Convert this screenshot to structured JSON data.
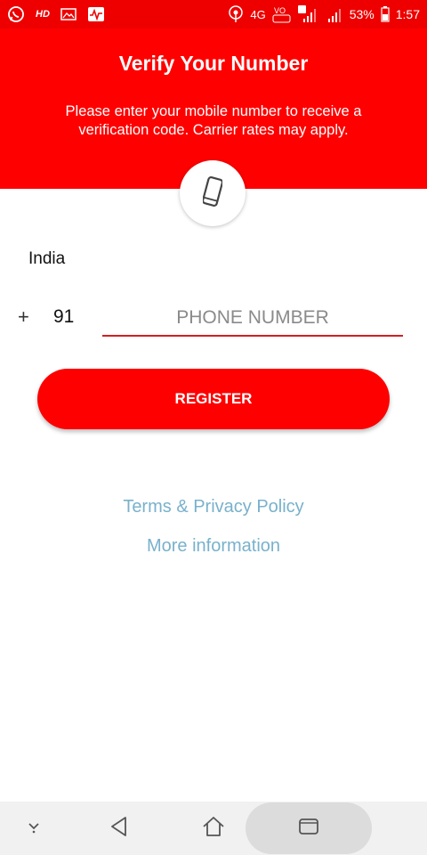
{
  "status_bar": {
    "left_icons": [
      "whatsapp-icon",
      "hd-icon",
      "image-icon",
      "activity-icon"
    ],
    "hd_text": "HD",
    "network_text": "4G",
    "battery_percent": "53%",
    "time": "1:57",
    "right_icons": [
      "hotspot-icon",
      "volte-icon",
      "signal-sim1-icon",
      "signal-sim2-icon",
      "battery-icon"
    ]
  },
  "header": {
    "title": "Verify Your Number",
    "subtitle": "Please enter your mobile number to receive a verification code. Carrier rates may apply.",
    "icon": "smartphone-icon",
    "background": "#ff0000"
  },
  "form": {
    "country": "India",
    "plus_symbol": "+",
    "country_code": "91",
    "phone_placeholder": "PHONE NUMBER",
    "phone_value": "",
    "register_label": "REGISTER",
    "accent": "#ff0000",
    "underline_color": "#d32020"
  },
  "links": {
    "terms": "Terms & Privacy Policy",
    "more_info": "More information",
    "color": "#79b1cc"
  },
  "nav_bar": {
    "icons": [
      "hide-keyboard-icon",
      "back-icon",
      "home-icon",
      "recent-apps-icon"
    ]
  }
}
